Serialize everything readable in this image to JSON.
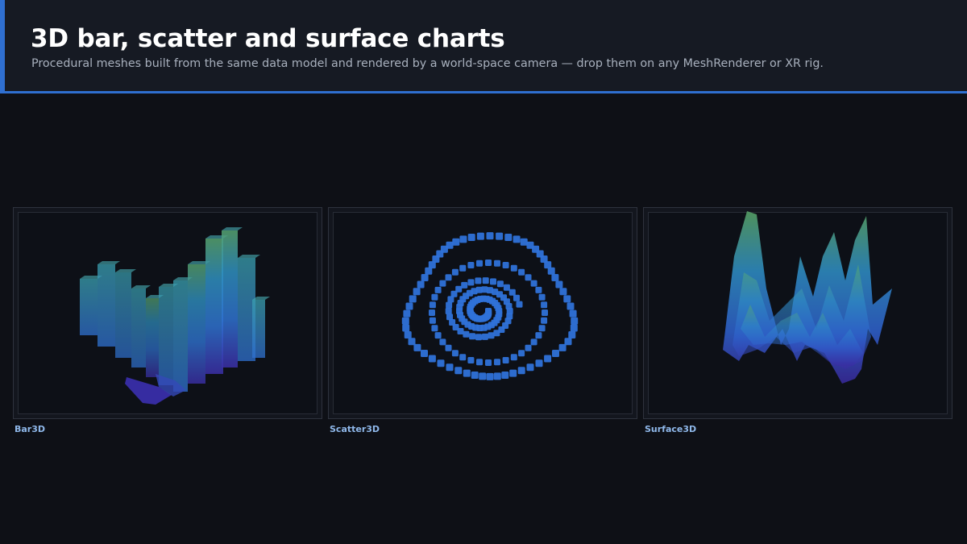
{
  "header": {
    "title": "3D bar, scatter and surface charts",
    "subtitle": "Procedural meshes built from the same data model and rendered by a world-space camera — drop them on any MeshRenderer or XR rig."
  },
  "colors": {
    "accent": "#2f6fd0",
    "scatter_point": "#2f72d8",
    "gradient_low": "#3b2fa8",
    "gradient_mid": "#2f7fd0",
    "gradient_high": "#5aa868"
  },
  "charts": [
    {
      "caption": "Bar3D"
    },
    {
      "caption": "Scatter3D"
    },
    {
      "caption": "Surface3D"
    }
  ]
}
